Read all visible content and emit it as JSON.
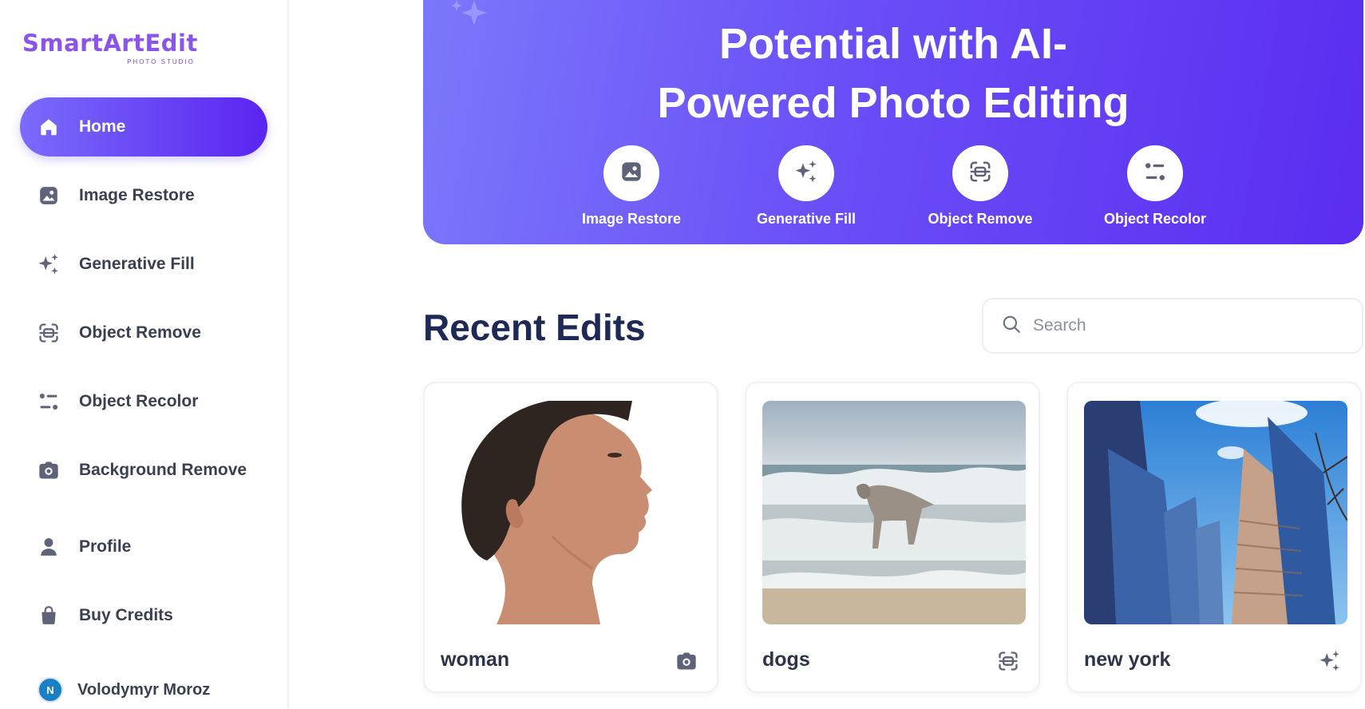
{
  "brand": {
    "name": "SmartArtEdit",
    "tagline": "PHOTO STUDIO",
    "accent": "#5b2df0"
  },
  "sidebar": {
    "items": [
      {
        "label": "Home",
        "icon": "home-icon",
        "active": true
      },
      {
        "label": "Image Restore",
        "icon": "image-icon",
        "active": false
      },
      {
        "label": "Generative Fill",
        "icon": "sparkles-icon",
        "active": false
      },
      {
        "label": "Object Remove",
        "icon": "scan-icon",
        "active": false
      },
      {
        "label": "Object Recolor",
        "icon": "recolor-icon",
        "active": false
      },
      {
        "label": "Background Remove",
        "icon": "camera-icon",
        "active": false
      },
      {
        "label": "Profile",
        "icon": "user-icon",
        "active": false
      },
      {
        "label": "Buy Credits",
        "icon": "bag-icon",
        "active": false
      }
    ],
    "user": {
      "initials": "N",
      "name": "Volodymyr Moroz"
    }
  },
  "hero": {
    "title_line1": "Potential with AI-",
    "title_line2": "Powered Photo Editing",
    "features": [
      {
        "label": "Image Restore",
        "icon": "image-icon"
      },
      {
        "label": "Generative Fill",
        "icon": "sparkles-icon"
      },
      {
        "label": "Object Remove",
        "icon": "scan-icon"
      },
      {
        "label": "Object Recolor",
        "icon": "recolor-icon"
      }
    ]
  },
  "recent": {
    "title": "Recent Edits",
    "search_placeholder": "Search",
    "cards": [
      {
        "title": "woman",
        "action_icon": "camera-icon"
      },
      {
        "title": "dogs",
        "action_icon": "scan-icon"
      },
      {
        "title": "new york",
        "action_icon": "sparkles-icon"
      }
    ]
  }
}
